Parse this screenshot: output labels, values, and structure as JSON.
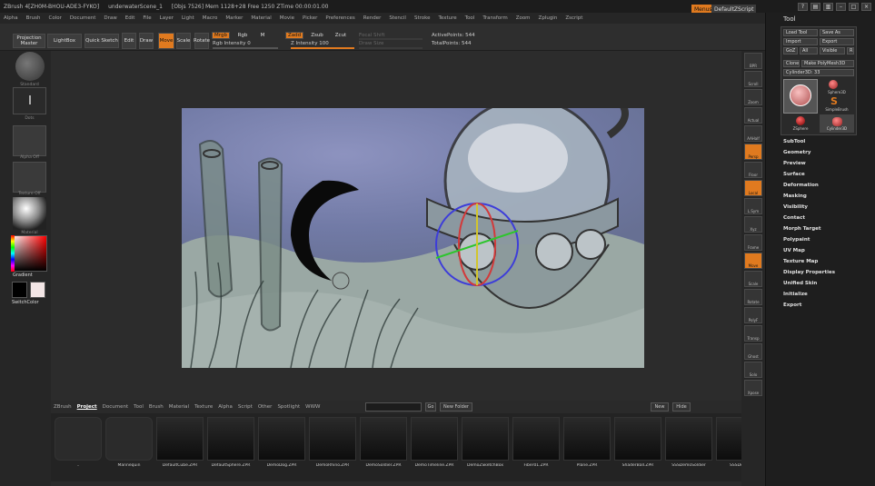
{
  "titlebar": {
    "app": "ZBrush 4[ZH0M-BHOU-ADE3-FYKO]",
    "doc": "underwaterScene_1",
    "objs": "[Objs 7526] Mem 1128+28 Free 1250 ZTime 00:00:01.00"
  },
  "menubar": {
    "items": [
      "Alpha",
      "Brush",
      "Color",
      "Document",
      "Draw",
      "Edit",
      "File",
      "Layer",
      "Light",
      "Macro",
      "Marker",
      "Material",
      "Movie",
      "Picker",
      "Preferences",
      "Render",
      "Stencil",
      "Stroke",
      "Texture",
      "Tool",
      "Transform",
      "Zoom",
      "Zplugin",
      "Zscript"
    ],
    "menus_btn": "Menus",
    "script_btn": "DefaultZScript"
  },
  "toolbar": {
    "projection_master": "Projection Master",
    "lightbox": "LightBox",
    "quick_sketch": "Quick Sketch",
    "edit": "Edit",
    "draw": "Draw",
    "move": "Move",
    "scale": "Scale",
    "rotate": "Rotate",
    "mrgb": "Mrgb",
    "rgb": "Rgb",
    "m": "M",
    "zadd": "Zadd",
    "zsub": "Zsub",
    "zcut": "Zcut",
    "rgb_intensity": "Rgb Intensity 0",
    "z_intensity": "Z Intensity 100",
    "focal_shift": "Focal Shift",
    "draw_size": "Draw Size",
    "active_points": "ActivePoints: 544",
    "total_points": "TotalPoints: 544",
    "rgb_intensity_level": 0,
    "z_intensity_level": 1.0
  },
  "leftshelf": {
    "labels": [
      "Standard",
      "Dots",
      "Alpha Off",
      "Texture Off",
      "Material"
    ],
    "gradient": "Gradient",
    "switch_color": "SwitchColor"
  },
  "rightshelf": {
    "items": [
      "BPR",
      "Scroll",
      "Zoom",
      "Actual",
      "AAHalf",
      "Persp",
      "Floor",
      "Local",
      "L.Sym",
      "Xyz",
      "Frame",
      "Move",
      "Scale",
      "Rotate",
      "PolyF",
      "Transp",
      "Ghost",
      "Solo",
      "Xpose"
    ]
  },
  "tray": {
    "title": "Tool",
    "buttons": {
      "load_tool": "Load Tool",
      "save_as": "Save As",
      "import": "Import",
      "export": "Export",
      "goz": "GoZ",
      "all": "All",
      "visible": "Visible",
      "r": "R",
      "clone": "Clone",
      "make_polymesh": "Make PolyMesh3D",
      "current_tool": "Cylinder3D: 33"
    },
    "tools": [
      "Cylinder3D",
      "Sphere3D",
      "SimpleBrush",
      "ZSphere",
      "Cylinder3D"
    ],
    "menu": [
      "SubTool",
      "Geometry",
      "Preview",
      "Surface",
      "Deformation",
      "Masking",
      "Visibility",
      "Contact",
      "Morph Target",
      "Polypaint",
      "UV Map",
      "Texture Map",
      "Display Properties",
      "Unified Skin",
      "Initialize",
      "Export"
    ]
  },
  "browser": {
    "tabs": [
      "ZBrush",
      "Project",
      "Document",
      "Tool",
      "Brush",
      "Material",
      "Texture",
      "Alpha",
      "Script",
      "Other",
      "Spotlight",
      "WWW"
    ],
    "active_tab": "Project",
    "path": "",
    "go": "Go",
    "new_folder": "New Folder",
    "new": "New",
    "hide": "Hide",
    "files": [
      "..",
      "Mannequin",
      "DefaultCube.ZPR",
      "DefaultSphere.ZPR",
      "DemoDog.ZPR",
      "DemoRhino.ZPR",
      "DemoSoldier.ZPR",
      "DemoTimeline.ZPR",
      "DemoZSketchBox",
      "Fiber01.ZPR",
      "Plane.ZPR",
      "ShaderBall.ZPR",
      "SSSDemoSoldier",
      "SSSDemo"
    ]
  },
  "colors": {
    "accent": "#e07a1f",
    "panel": "#2a2a2a",
    "canvas": "#95a4a0"
  }
}
